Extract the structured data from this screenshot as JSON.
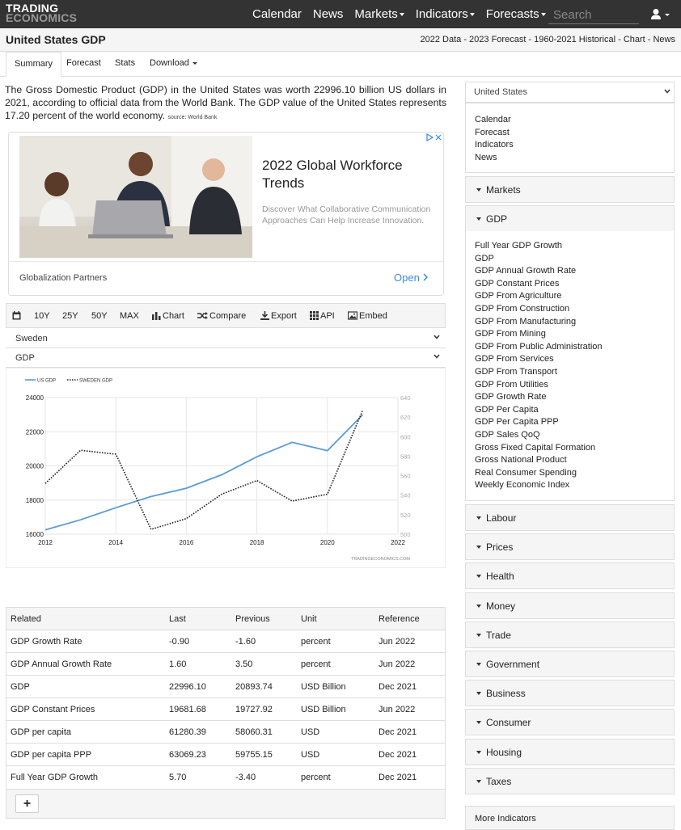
{
  "brand": {
    "line1": "TRADING",
    "line2": "ECONOMICS"
  },
  "nav": [
    {
      "label": "Calendar",
      "dropdown": false
    },
    {
      "label": "News",
      "dropdown": false
    },
    {
      "label": "Markets",
      "dropdown": true
    },
    {
      "label": "Indicators",
      "dropdown": true
    },
    {
      "label": "Forecasts",
      "dropdown": true
    }
  ],
  "search": {
    "placeholder": "Search"
  },
  "page": {
    "title": "United States GDP",
    "links": "2022 Data - 2023 Forecast - 1960-2021 Historical - Chart - News"
  },
  "tabs": [
    "Summary",
    "Forecast",
    "Stats",
    "Download"
  ],
  "description": {
    "text": "The Gross Domestic Product (GDP) in the United States was worth 22996.10 billion US dollars in 2021, according to official data from the World Bank. The GDP value of the United States represents 17.20 percent of the world economy.",
    "source": "source: World Bank"
  },
  "ad": {
    "title": "2022 Global Workforce Trends",
    "text": "Discover What Collaborative Communication Approaches Can Help Increase Innovation.",
    "brand": "Globalization Partners",
    "cta": "Open"
  },
  "chart_toolbar": {
    "ranges": [
      "10Y",
      "25Y",
      "50Y",
      "MAX"
    ],
    "chart": "Chart",
    "compare": "Compare",
    "export": "Export",
    "api": "API",
    "embed": "Embed"
  },
  "compare_country": "Sweden",
  "compare_indicator": "GDP",
  "chart_data": {
    "type": "line",
    "x": [
      2012,
      2013,
      2014,
      2015,
      2016,
      2017,
      2018,
      2019,
      2020,
      2021
    ],
    "series": [
      {
        "name": "US GDP",
        "axis": "left",
        "color": "#5b9bd5",
        "dash": "solid",
        "values": [
          16254,
          16843,
          17551,
          18206,
          18695,
          19477,
          20533,
          21381,
          20894,
          22996
        ]
      },
      {
        "name": "SWEDEN GDP",
        "axis": "right",
        "color": "#222222",
        "dash": "dotted",
        "values": [
          552,
          586,
          582,
          505,
          516,
          541,
          555,
          534,
          541,
          627
        ]
      }
    ],
    "x_ticks": [
      2012,
      2014,
      2016,
      2018,
      2020,
      2022
    ],
    "xlim": [
      2012,
      2022
    ],
    "y_left": {
      "ticks": [
        16000,
        18000,
        20000,
        22000,
        24000
      ],
      "lim": [
        16000,
        24000
      ]
    },
    "y_right": {
      "ticks": [
        500,
        520,
        540,
        560,
        580,
        600,
        620,
        640
      ],
      "lim": [
        500,
        640
      ]
    },
    "grid": true,
    "legend": "top-left",
    "watermark": "TRADINGECONOMICS.COM"
  },
  "related": {
    "headers": [
      "Related",
      "Last",
      "Previous",
      "Unit",
      "Reference"
    ],
    "rows": [
      [
        "GDP Growth Rate",
        "-0.90",
        "-1.60",
        "percent",
        "Jun 2022"
      ],
      [
        "GDP Annual Growth Rate",
        "1.60",
        "3.50",
        "percent",
        "Jun 2022"
      ],
      [
        "GDP",
        "22996.10",
        "20893.74",
        "USD Billion",
        "Dec 2021"
      ],
      [
        "GDP Constant Prices",
        "19681.68",
        "19727.92",
        "USD Billion",
        "Jun 2022"
      ],
      [
        "GDP per capita",
        "61280.39",
        "58060.31",
        "USD",
        "Dec 2021"
      ],
      [
        "GDP per capita PPP",
        "63069.23",
        "59755.15",
        "USD",
        "Dec 2021"
      ],
      [
        "Full Year GDP Growth",
        "5.70",
        "-3.40",
        "percent",
        "Dec 2021"
      ]
    ],
    "add": "+"
  },
  "sidebar": {
    "country": "United States",
    "links": [
      "Calendar",
      "Forecast",
      "Indicators",
      "News"
    ],
    "markets": "Markets",
    "gdp": "GDP",
    "gdp_links": [
      "Full Year GDP Growth",
      "GDP",
      "GDP Annual Growth Rate",
      "GDP Constant Prices",
      "GDP From Agriculture",
      "GDP From Construction",
      "GDP From Manufacturing",
      "GDP From Mining",
      "GDP From Public Administration",
      "GDP From Services",
      "GDP From Transport",
      "GDP From Utilities",
      "GDP Growth Rate",
      "GDP Per Capita",
      "GDP Per Capita PPP",
      "GDP Sales QoQ",
      "Gross Fixed Capital Formation",
      "Gross National Product",
      "Real Consumer Spending",
      "Weekly Economic Index"
    ],
    "categories": [
      "Labour",
      "Prices",
      "Health",
      "Money",
      "Trade",
      "Government",
      "Business",
      "Consumer",
      "Housing",
      "Taxes"
    ],
    "more": "More Indicators"
  }
}
